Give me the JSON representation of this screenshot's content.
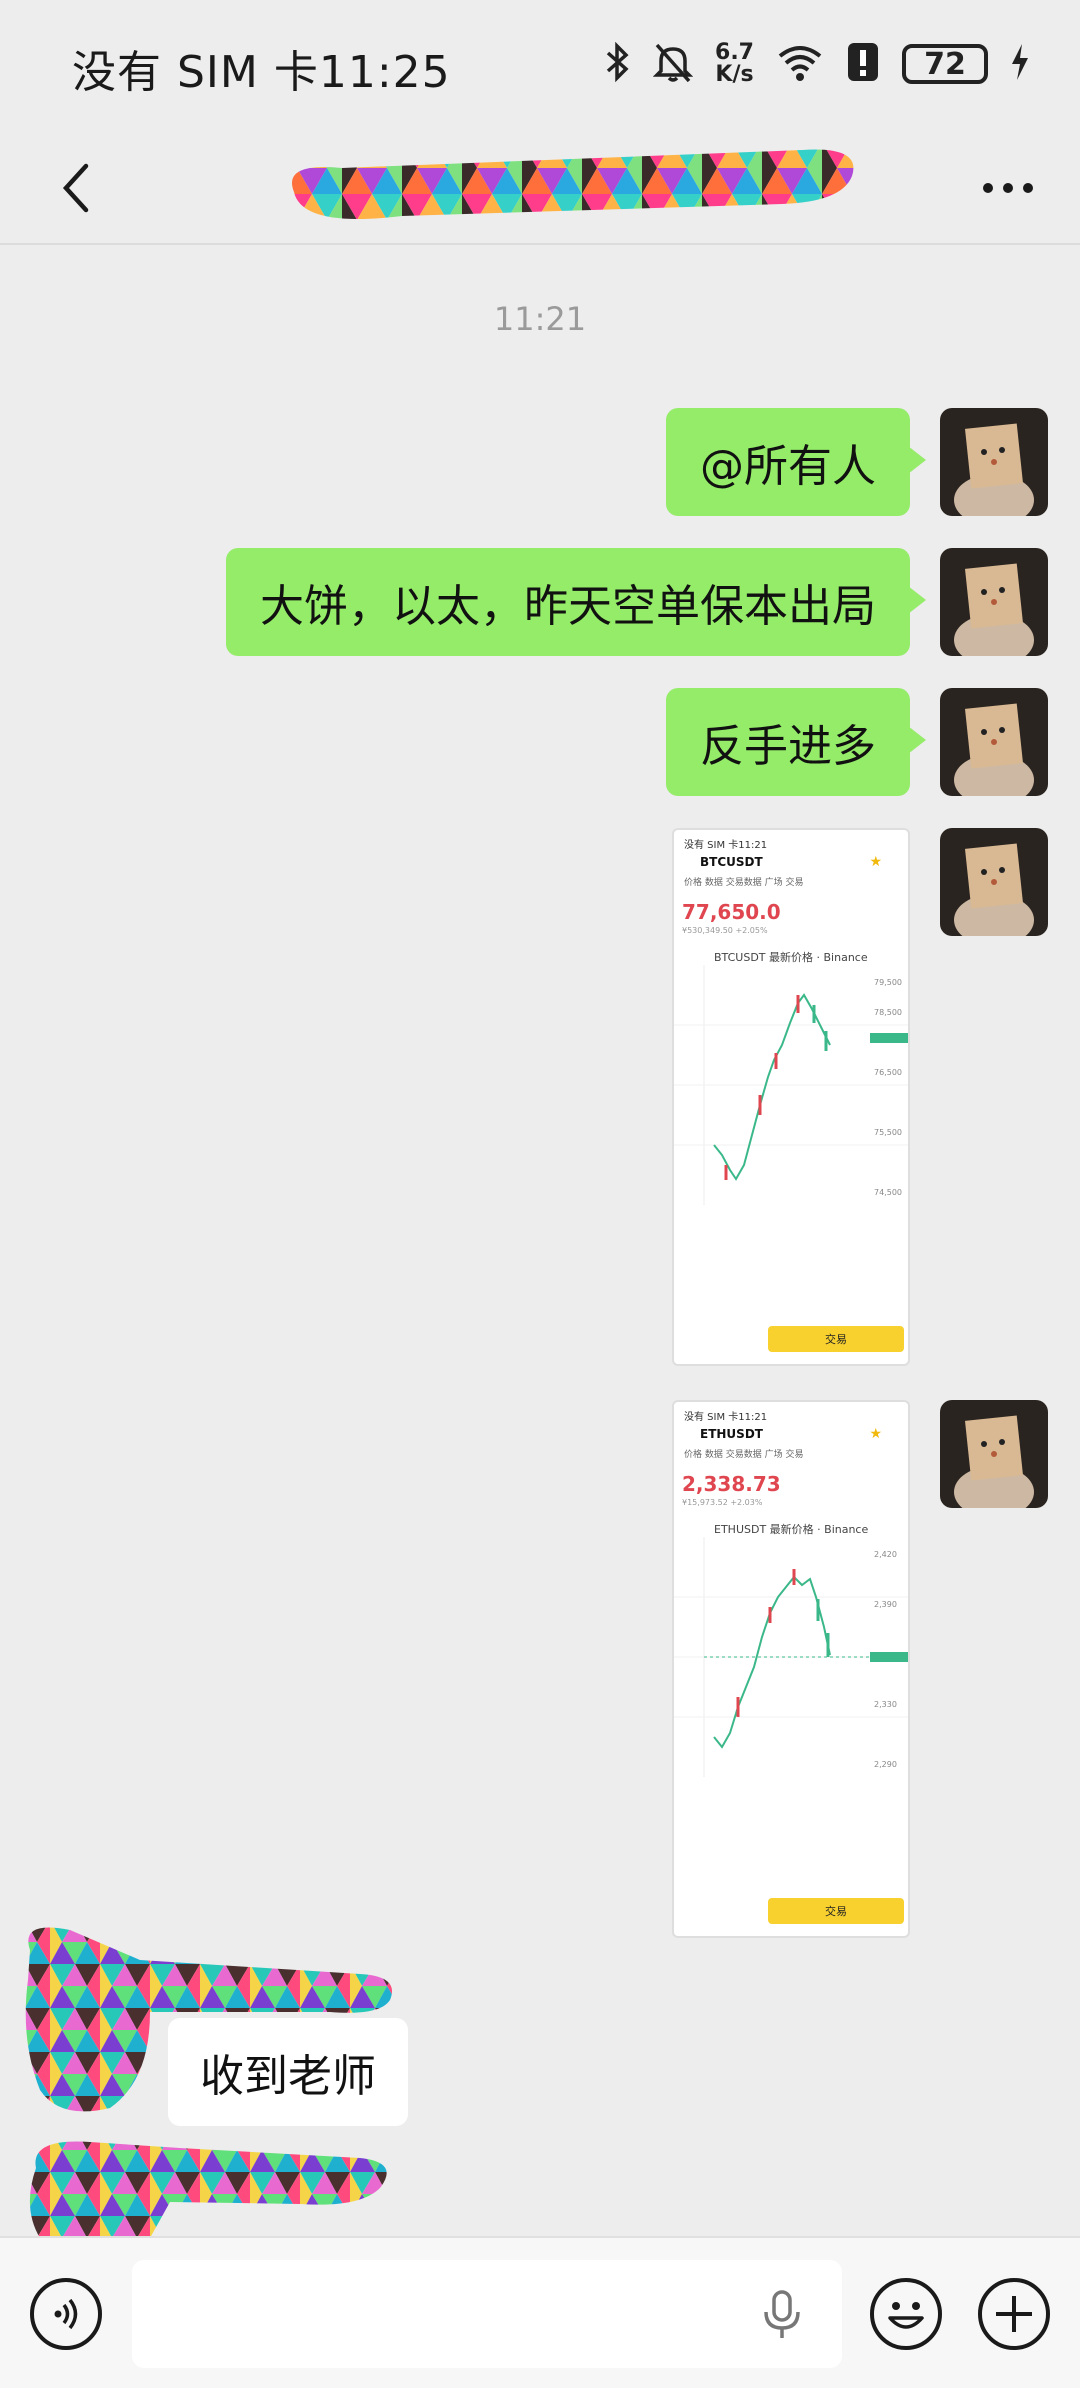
{
  "status_bar": {
    "carrier_time": "没有 SIM 卡11:25",
    "net_speed_value": "6.7",
    "net_speed_unit": "K/s",
    "battery": "72"
  },
  "chat": {
    "timestamp": "11:21",
    "messages": [
      {
        "text": "@所有人"
      },
      {
        "text": "大饼，以太，昨天空单保本出局"
      },
      {
        "text": "反手进多"
      }
    ],
    "incoming_reply": "收到老师"
  },
  "screenshot_btc": {
    "status": "没有 SIM 卡11:21",
    "pair": "BTCUSDT",
    "tabs": "价格   数据   交易数据   广场   交易",
    "price": "77,650.0",
    "sub": "¥530,349.50  +2.05%",
    "chart_title": "BTCUSDT 最新价格 · Binance",
    "trade_button": "交易"
  },
  "screenshot_eth": {
    "status": "没有 SIM 卡11:21",
    "pair": "ETHUSDT",
    "tabs": "价格   数据   交易数据   广场   交易",
    "price": "2,338.73",
    "sub": "¥15,973.52  +2.03%",
    "chart_title": "ETHUSDT 最新价格 · Binance",
    "trade_button": "交易"
  },
  "colors": {
    "outgoing_bubble": "#95ec69",
    "incoming_bubble": "#ffffff",
    "background": "#ededed",
    "price_red": "#e0464f",
    "trade_yellow": "#f8d12f"
  },
  "icons": {
    "back": "chevron-left-icon",
    "more": "more-dots-icon",
    "voice": "voice-icon",
    "mic": "mic-icon",
    "emoji": "emoji-icon",
    "plus": "plus-icon"
  }
}
